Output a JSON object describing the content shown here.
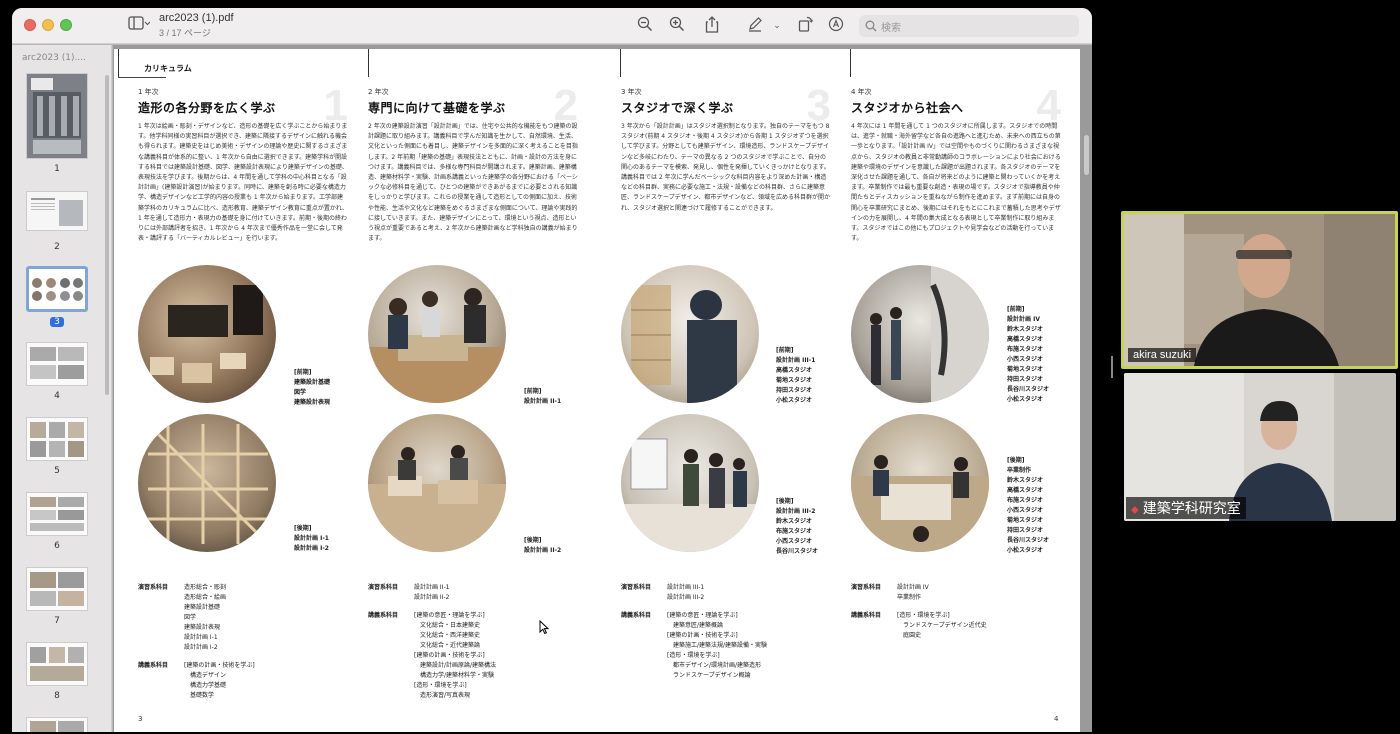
{
  "window": {
    "doc_title": "arc2023 (1).pdf",
    "page_indicator": "3 / 17 ページ",
    "search_placeholder": "検索"
  },
  "sidebar": {
    "title": "arc2023 (1)....",
    "thumbs": [
      {
        "num": "1",
        "selected": false
      },
      {
        "num": "2",
        "selected": false
      },
      {
        "num": "3",
        "selected": true
      },
      {
        "num": "4",
        "selected": false
      },
      {
        "num": "5",
        "selected": false
      },
      {
        "num": "6",
        "selected": false
      },
      {
        "num": "7",
        "selected": false
      },
      {
        "num": "8",
        "selected": false
      }
    ]
  },
  "page": {
    "section": "カリキュラム",
    "columns": [
      {
        "year": "1 年次",
        "num": "1",
        "title": "造形の各分野を広く学ぶ",
        "body": "1 年次は絵画・彫刻・デザインなど、造形の基礎を広く学ぶことから始まります。他学科同様の実習科目が選択でき、建築に隣接するデザインに触れる機会も得られます。建築史をはじめ美術・デザインの理論や歴史に関するさまざまな講義科目が体系的に整い、1 年次から自由に選択できます。建築学科が開設する科目では建築設計基礎、図学、建築設計表現により建築デザインの基礎、表現技法を学びます。後期からは、4 年間を通して学科の中心科目となる「設計計画」(建築設計演習)が始まります。同時に、建築を創る時に必要な構造力学、構造デザインなど工学的内容の授業も 1 年次から始まります。工学部建築学科のカリキュラムに比べ、造形教育、建築デザイン教育に重点が置かれ、1 年を通して造形力・表現力の基礎を身に付けていきます。前期・後期の終わりには外部講評者を招き、1 年次から 4 年次まで優秀作品を一堂に会して発表・講評する「バーティカルレビュー」を行います。"
      },
      {
        "year": "2 年次",
        "num": "2",
        "title": "専門に向けて基礎を学ぶ",
        "body": "2 年次の建築設計演習「設計計画」では、住宅や公共的な機能をもつ建築の設計課題に取り組みます。講義科目で学んだ知識を生かして、自然環境、生活、文化といった側面にも着目し、建築デザインを多面的に深く考えることを目指します。2 年前期「建築の基礎」表現技法とともに、計画・設計の方法を身につけます。講義科目では、多様な専門科目が開講されます。建築計画、建築構造、建築材料学・実験、計画系講義といった建築学の各分野における「ベーシックな必修科目を通じて、ひとつの建築ができあがるまでに必要とされる知識をしっかりと学びます。これらの授業を通して造形としての側面に加え、技術や性能、生活や文化など建築をめぐるさまざまな側面について、理論や実践的に接していきます。また、建築デザインにとって、環境という視点、造形という視点が重要であると考え、2 年次から建築計画など学科独自の講義が始まります。"
      },
      {
        "year": "3 年次",
        "num": "3",
        "title": "スタジオで深く学ぶ",
        "body": "3 年次から「設計計画」はスタジオ選択制となります。独自のテーマをもつ 8 スタジオ(前期 4 スタジオ・後期 4 スタジオ)から各期 1 スタジオずつを選択して学びます。分野としても建築デザイン、環境造形、ランドスケープデザインなど多岐にわたり、テーマの異なる 2 つのスタジオで学ぶことで、自分の関心のあるテーマを模索、発見し、個性を発揮していくきっかけとなります。講義科目では 2 年次に学んだベーシックな科目内容をより深めた計画・構造などの科目群、実務に必要な施工・法規・設備などの科目群、さらに建築意匠、ランドスケープデザイン、都市デザインなど、領域を広める科目群が開かれ、スタジオ選択と関連づけて履修することができます。"
      },
      {
        "year": "4 年次",
        "num": "4",
        "title": "スタジオから社会へ",
        "body": "4 年次には 1 年間を通して 1 つのスタジオに所属します。スタジオでの時間は、進学・就職・海外留学など各自の進路へと進むため、未来への西立ちの第一歩となります。「設計計画 IV」では空間やものづくりに関わるさまざまな視点から、スタジオの教員と非常勤講師のコラボレーションにより社会における建築や環境のデザインを意識した課題が出題されます。各スタジオのテーマを深化させた課題を通して、各自が将来どのように建築と関わっていくかを考えます。卒業制作では最も重要な創造・表現の場です。スタジオで指導教員や仲間たちとディスカッションを重ねながら制作を進めます。まず前期には自身の関心を卒業研究にまとめ、後期にはそれをもとにこれまで蓄積した思考やデザインの力を展開し、4 年間の集大成となる表現として卒業制作に取り組みます。スタジオではこの他にもプロジェクトや見学会などの活動を行っています。"
      }
    ],
    "labels": {
      "c1_top": [
        "[前期]",
        "建築設計基礎",
        "図学",
        "建築設計表現"
      ],
      "c1_bottom": [
        "[後期]",
        "設計計画 I-1",
        "設計計画 I-2"
      ],
      "c2_top": [
        "[前期]",
        "設計計画 II-1"
      ],
      "c2_bottom": [
        "[後期]",
        "設計計画 II-2"
      ],
      "c3_top": [
        "[前期]",
        "設計計画 III-1",
        "高橋スタジオ",
        "菊地スタジオ",
        "持田スタジオ",
        "小松スタジオ"
      ],
      "c3_bottom": [
        "[後期]",
        "設計計画 III-2",
        "鈴木スタジオ",
        "布施スタジオ",
        "小西スタジオ",
        "長谷川スタジオ"
      ],
      "c4_top": [
        "[前期]",
        "設計計画 IV",
        "鈴木スタジオ",
        "高橋スタジオ",
        "布施スタジオ",
        "小西スタジオ",
        "菊地スタジオ",
        "持田スタジオ",
        "長谷川スタジオ",
        "小松スタジオ"
      ],
      "c4_bottom": [
        "[後期]",
        "卒業制作",
        "鈴木スタジオ",
        "高橋スタジオ",
        "布施スタジオ",
        "小西スタジオ",
        "菊地スタジオ",
        "持田スタジオ",
        "長谷川スタジオ",
        "小松スタジオ"
      ]
    },
    "subjects": {
      "c1_practice_key": "演習系科目",
      "c1_practice": [
        "造形総合・彫刻",
        "造形総合・絵画",
        "建築設計基礎",
        "図学",
        "建築設計表現",
        "設計計画 I-1",
        "設計計画 I-2"
      ],
      "c1_lecture_key": "講義系科目",
      "c1_lecture": [
        "[建築の計画・技術を学ぶ]",
        "　構造デザイン",
        "　構造力学基礎",
        "　基礎数学"
      ],
      "c2_practice_key": "演習系科目",
      "c2_practice": [
        "設計計画 II-1",
        "設計計画 II-2"
      ],
      "c2_lecture_key": "講義系科目",
      "c2_lecture": [
        "[建築の意匠・理論を学ぶ]",
        "　文化総合・日本建築史",
        "　文化総合・西洋建築史",
        "　文化総合・近代建築論",
        "[建築の計画・技術を学ぶ]",
        "　建築設計/計画原論/建築構法",
        "　構造力学/建築材料学・実験",
        "[造形・環境を学ぶ]",
        "　造形演習/写真表現"
      ],
      "c3_practice_key": "演習系科目",
      "c3_practice": [
        "設計計画 III-1",
        "設計計画 III-2"
      ],
      "c3_lecture_key": "講義系科目",
      "c3_lecture": [
        "[建築の意匠・理論を学ぶ]",
        "　建築意匠/建築概論",
        "[建築の計画・技術を学ぶ]",
        "　建築施工/建築法規/建築設備・実験",
        "[造形・環境を学ぶ]",
        "　都市デザイン/環境計画/建築造形",
        "　ランドスケープデザイン概論"
      ],
      "c4_practice_key": "演習系科目",
      "c4_practice": [
        "設計計画 IV",
        "卒業制作"
      ],
      "c4_lecture_key": "講義系科目",
      "c4_lecture": [
        "[造形・環境を学ぶ]",
        "　ランドスケープデザイン近代史",
        "　庭園史"
      ]
    },
    "page_left": "3",
    "page_right": "4"
  },
  "video": {
    "participant1": "akira suzuki",
    "participant2": "建築学科研究室"
  },
  "colors": {
    "active_speaker_border": "#c6d64a",
    "selected_page_badge": "#2f6fe0"
  }
}
